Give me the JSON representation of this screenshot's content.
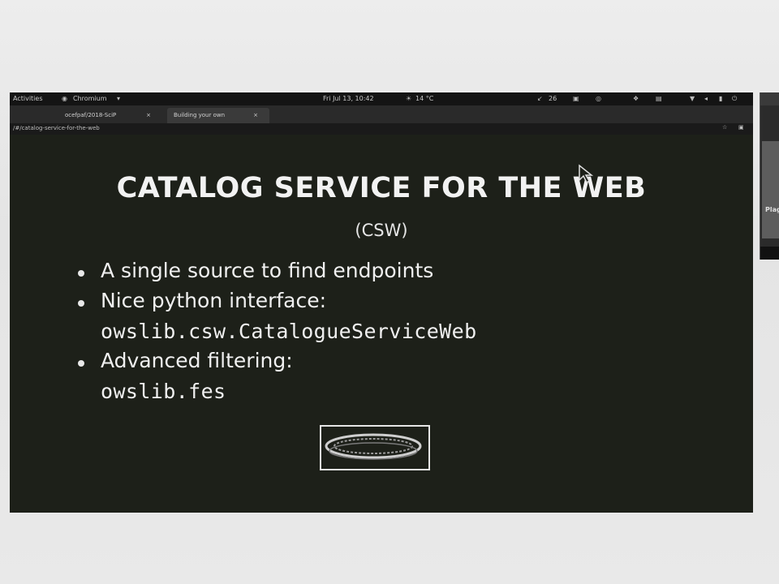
{
  "topbar": {
    "activities": "Activities",
    "app_name": "Chromium",
    "datetime": "Fri Jul 13, 10:42",
    "weather": "14 °C",
    "battery": "26"
  },
  "tabs": [
    {
      "label": "ocefpaf/2018-SciP"
    },
    {
      "label": "Building your own"
    }
  ],
  "address_bar": {
    "url": "/#/catalog-service-for-the-web"
  },
  "slide": {
    "title": "CATALOG SERVICE FOR THE WEB",
    "subtitle": "(CSW)",
    "bullets": [
      {
        "text": "A single source to find endpoints"
      },
      {
        "text": "Nice python interface:",
        "code": "owslib.csw.CatalogueServiceWeb"
      },
      {
        "text": "Advanced filtering:",
        "code": "owslib.fes"
      }
    ]
  },
  "side_window": {
    "label": "Plagi"
  },
  "colors": {
    "slide_background": "#1d2019",
    "slide_text": "#f0f0f0",
    "outer_background": "#e8e8e8"
  }
}
